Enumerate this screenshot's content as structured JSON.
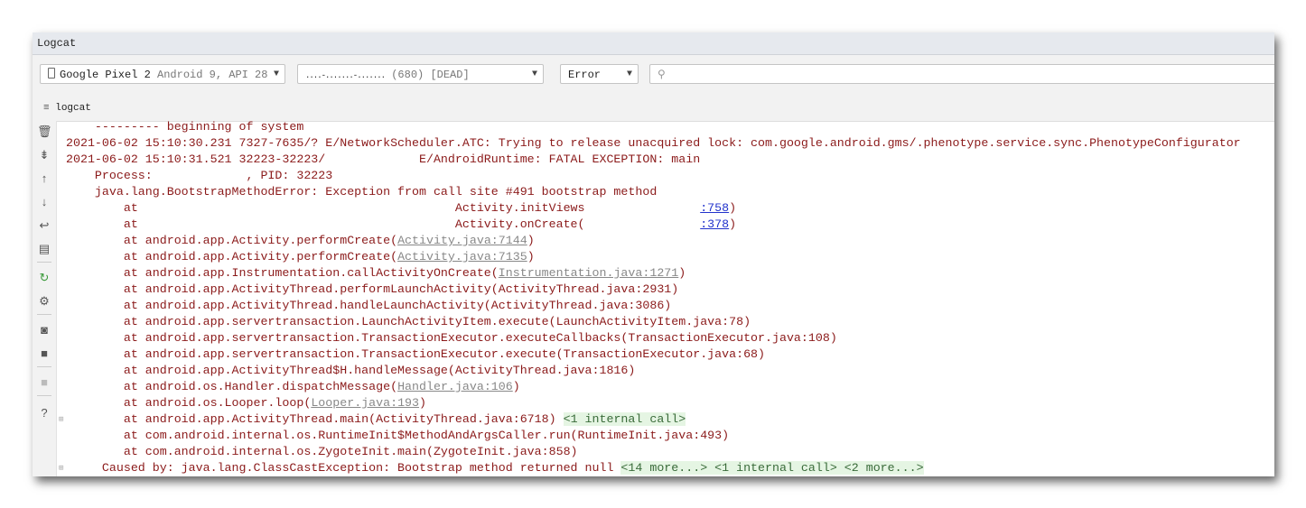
{
  "window": {
    "title": "Logcat"
  },
  "toolbar": {
    "device": {
      "name": "Google Pixel 2",
      "detail": "Android 9, API 28"
    },
    "process": {
      "name": "....-.......-.......",
      "detail": "(680) [DEAD]"
    },
    "level": "Error",
    "search_placeholder": ""
  },
  "tab": {
    "label": "logcat"
  },
  "sidebar_icons": [
    "trash-icon",
    "scroll-to-end-icon",
    "up-arrow-icon",
    "down-arrow-icon",
    "soft-wrap-icon",
    "print-icon",
    "restart-icon",
    "settings-icon",
    "screenshot-icon",
    "screen-record-icon",
    "stop-icon",
    "help-icon"
  ],
  "log_lines": [
    {
      "segments": [
        {
          "t": "    --------- beginning of system"
        }
      ]
    },
    {
      "segments": [
        {
          "t": "2021-06-02 15:10:30.231 7327-7635/? E/NetworkScheduler.ATC: Trying to release unacquired lock: com.google.android.gms/.phenotype.service.sync.PhenotypeConfigurator"
        }
      ]
    },
    {
      "segments": [
        {
          "t": "2021-06-02 15:10:31.521 32223-32223/             E/AndroidRuntime: FATAL EXCEPTION: main"
        }
      ]
    },
    {
      "segments": [
        {
          "t": "    Process:             , PID: 32223"
        }
      ]
    },
    {
      "segments": [
        {
          "t": "    java.lang.BootstrapMethodError: Exception from call site #491 bootstrap method"
        }
      ]
    },
    {
      "segments": [
        {
          "t": "        at                                            Activity.initViews                "
        },
        {
          "t": ":758",
          "s": "blue"
        },
        {
          "t": ")"
        }
      ]
    },
    {
      "segments": [
        {
          "t": "        at                                            Activity.onCreate(                "
        },
        {
          "t": ":378",
          "s": "blue"
        },
        {
          "t": ")"
        }
      ]
    },
    {
      "segments": [
        {
          "t": "        at android.app.Activity.performCreate("
        },
        {
          "t": "Activity.java:7144",
          "s": "link"
        },
        {
          "t": ")"
        }
      ]
    },
    {
      "segments": [
        {
          "t": "        at android.app.Activity.performCreate("
        },
        {
          "t": "Activity.java:7135",
          "s": "link"
        },
        {
          "t": ")"
        }
      ]
    },
    {
      "segments": [
        {
          "t": "        at android.app.Instrumentation.callActivityOnCreate("
        },
        {
          "t": "Instrumentation.java:1271",
          "s": "link"
        },
        {
          "t": ")"
        }
      ]
    },
    {
      "segments": [
        {
          "t": "        at android.app.ActivityThread.performLaunchActivity(ActivityThread.java:2931)"
        }
      ]
    },
    {
      "segments": [
        {
          "t": "        at android.app.ActivityThread.handleLaunchActivity(ActivityThread.java:3086)"
        }
      ]
    },
    {
      "segments": [
        {
          "t": "        at android.app.servertransaction.LaunchActivityItem.execute(LaunchActivityItem.java:78)"
        }
      ]
    },
    {
      "segments": [
        {
          "t": "        at android.app.servertransaction.TransactionExecutor.executeCallbacks(TransactionExecutor.java:108)"
        }
      ]
    },
    {
      "segments": [
        {
          "t": "        at android.app.servertransaction.TransactionExecutor.execute(TransactionExecutor.java:68)"
        }
      ]
    },
    {
      "segments": [
        {
          "t": "        at android.app.ActivityThread$H.handleMessage(ActivityThread.java:1816)"
        }
      ]
    },
    {
      "segments": [
        {
          "t": "        at android.os.Handler.dispatchMessage("
        },
        {
          "t": "Handler.java:106",
          "s": "link"
        },
        {
          "t": ")"
        }
      ]
    },
    {
      "segments": [
        {
          "t": "        at android.os.Looper.loop("
        },
        {
          "t": "Looper.java:193",
          "s": "link"
        },
        {
          "t": ")"
        }
      ]
    },
    {
      "fold": true,
      "segments": [
        {
          "t": "        at android.app.ActivityThread.main(ActivityThread.java:6718) "
        },
        {
          "t": "<1 internal call>",
          "s": "fold"
        }
      ]
    },
    {
      "segments": [
        {
          "t": "        at com.android.internal.os.RuntimeInit$MethodAndArgsCaller.run(RuntimeInit.java:493)"
        }
      ]
    },
    {
      "segments": [
        {
          "t": "        at com.android.internal.os.ZygoteInit.main(ZygoteInit.java:858)"
        }
      ]
    },
    {
      "fold": true,
      "segments": [
        {
          "t": "     Caused by: java.lang.ClassCastException: Bootstrap method returned null "
        },
        {
          "t": "<14 more...> <1 internal call> <2 more...>",
          "s": "fold"
        }
      ]
    }
  ]
}
